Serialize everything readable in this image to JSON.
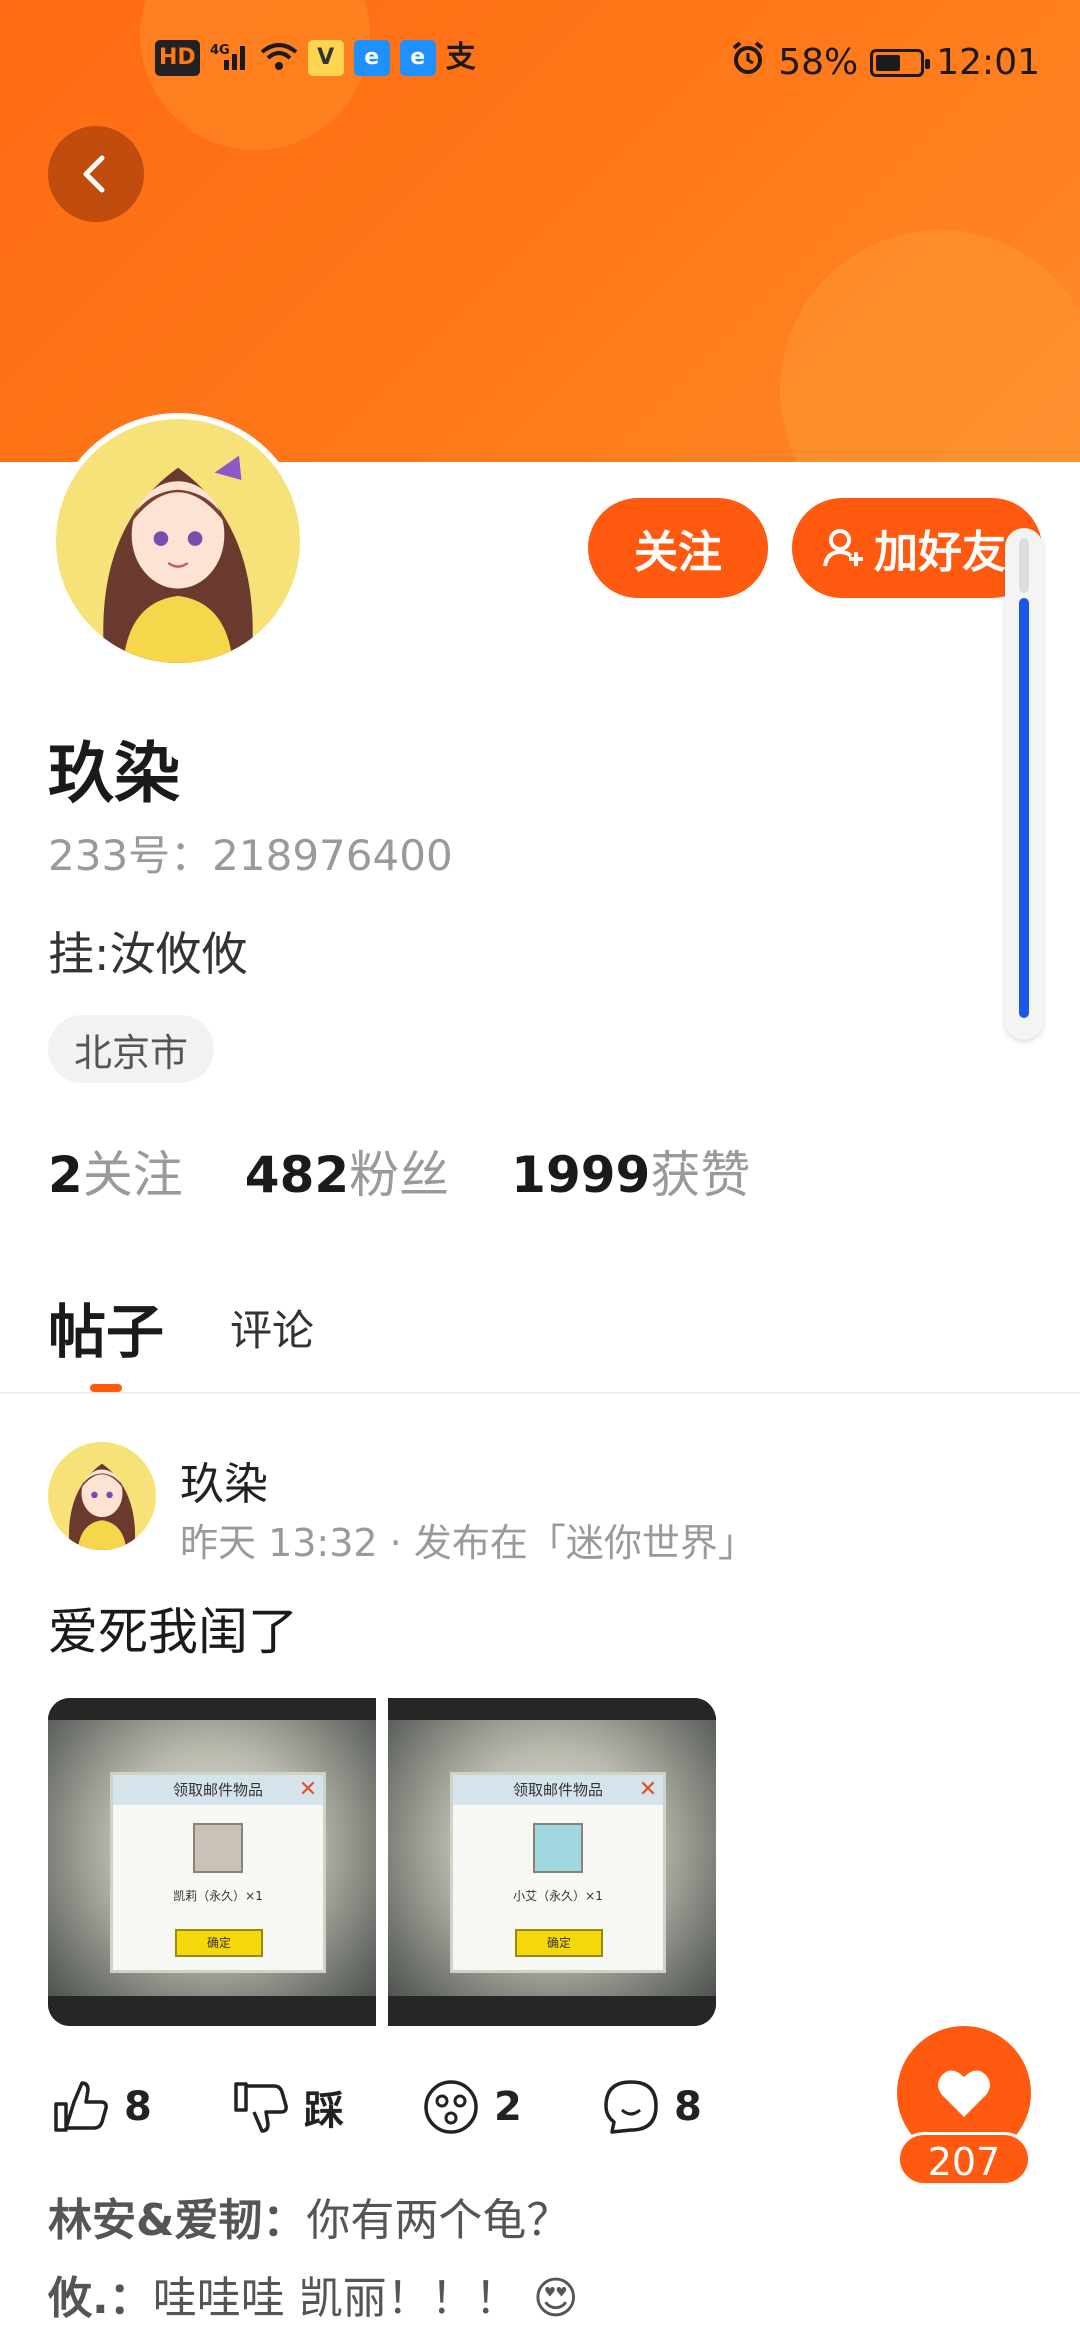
{
  "status_bar": {
    "left_icons": [
      "hd-icon",
      "4g-signal-icon",
      "wifi-icon",
      "app-icon-yellow",
      "app-icon-e1",
      "app-icon-e2",
      "alipay-icon"
    ],
    "hd": "HD",
    "net": "4G",
    "battery": "58%",
    "battery_level": 0.58,
    "time": "12:01"
  },
  "profile": {
    "follow_button": "关注",
    "add_friend_button": "加好友",
    "name": "玖染",
    "uid": "233号：218976400",
    "bio": "挂:汝攸攸",
    "location": "北京市",
    "stats": [
      {
        "value": "2",
        "label": "关注"
      },
      {
        "value": "482",
        "label": "粉丝"
      },
      {
        "value": "1999",
        "label": "获赞"
      }
    ]
  },
  "tabs": {
    "posts": "帖子",
    "comments": "评论"
  },
  "post": {
    "author": "玖染",
    "meta": "昨天 13:32 · 发布在「迷你世界」",
    "text": "爱死我闺了",
    "images": [
      {
        "dialog_title": "领取邮件物品",
        "item_text": "凯莉（永久）×1",
        "ok": "确定"
      },
      {
        "dialog_title": "领取邮件物品",
        "item_text": "小艾（永久）×1",
        "ok": "确定"
      }
    ],
    "actions": {
      "like": "8",
      "dislike": "踩",
      "reaction": "2",
      "comment": "8"
    },
    "fab_like_count": "207",
    "comments": [
      {
        "user": "林安&爱韧：",
        "text": "你有两个龟？"
      },
      {
        "user": "攸.：",
        "text": "哇哇哇 凯丽！！！ 😍"
      }
    ]
  },
  "colors": {
    "accent": "#ff5a0f",
    "banner": "#ff7a1a",
    "scroll_thumb": "#1a56e8"
  }
}
